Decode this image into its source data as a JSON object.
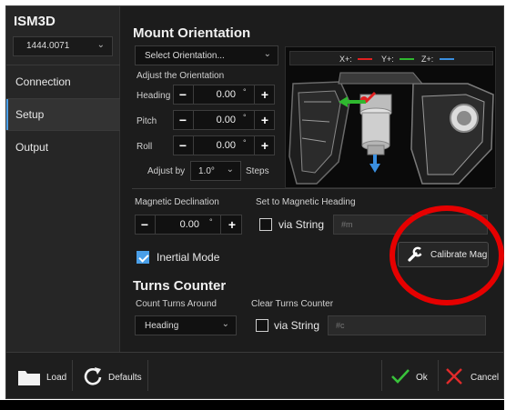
{
  "app": {
    "title": "ISM3D",
    "serial": "1444.0071"
  },
  "sidebar": {
    "items": [
      {
        "label": "Connection"
      },
      {
        "label": "Setup"
      },
      {
        "label": "Output"
      }
    ]
  },
  "mount": {
    "title": "Mount Orientation",
    "select_placeholder": "Select Orientation...",
    "adjust_label": "Adjust the Orientation",
    "heading_label": "Heading",
    "heading_value": "0.00",
    "pitch_label": "Pitch",
    "pitch_value": "0.00",
    "roll_label": "Roll",
    "roll_value": "0.00",
    "unit": "°",
    "adjust_by_label": "Adjust by",
    "adjust_by_value": "1.0°",
    "steps_label": "Steps"
  },
  "axes_legend": {
    "x": "X+:",
    "y": "Y+:",
    "z": "Z+:",
    "x_color": "#e02020",
    "y_color": "#2fb82f",
    "z_color": "#3a8fe0"
  },
  "mag": {
    "declination_label": "Magnetic Declination",
    "declination_value": "0.00",
    "unit": "°",
    "set_heading_label": "Set to Magnetic Heading",
    "via_string": "via String",
    "string_placeholder": "#m",
    "inertial_label": "Inertial Mode",
    "inertial_checked": true,
    "calibrate_label": "Calibrate Mag"
  },
  "turns": {
    "title": "Turns Counter",
    "count_label": "Count Turns Around",
    "count_value": "Heading",
    "clear_label": "Clear Turns Counter",
    "via_string": "via String",
    "string_placeholder": "#c"
  },
  "footer": {
    "load": "Load",
    "defaults": "Defaults",
    "ok": "Ok",
    "cancel": "Cancel"
  },
  "colors": {
    "accent": "#4a9fe8",
    "highlight_ring": "#e60000",
    "ok": "#39c33b",
    "cancel": "#e02b2b"
  }
}
